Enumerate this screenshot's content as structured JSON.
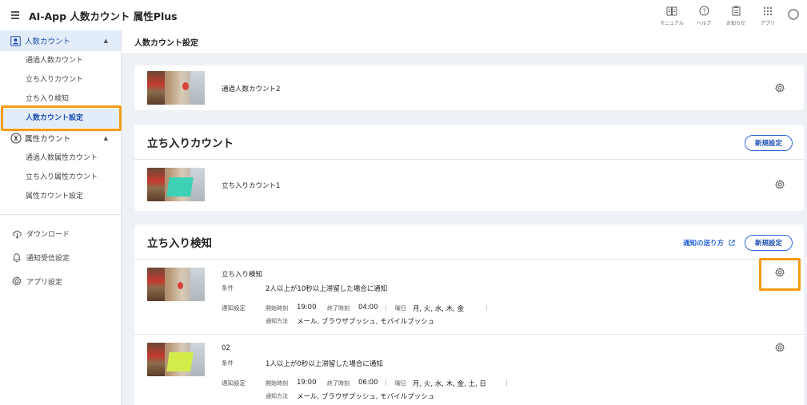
{
  "header": {
    "title": "AI-App 人数カウント 属性Plus",
    "icons": [
      {
        "icon": "manual-icon",
        "label": "マニュアル"
      },
      {
        "icon": "help-icon",
        "label": "ヘルプ"
      },
      {
        "icon": "notice-icon",
        "label": "お知らせ"
      },
      {
        "icon": "apps-icon",
        "label": "アプリ"
      }
    ]
  },
  "sidebar": {
    "group1": {
      "label": "人数カウント",
      "items": [
        "通過人数カウント",
        "立ち入りカウント",
        "立ち入り検知",
        "人数カウント設定"
      ]
    },
    "group2": {
      "label": "属性カウント",
      "items": [
        "通過人数属性カウント",
        "立ち入り属性カウント",
        "属性カウント設定"
      ]
    },
    "download": "ダウンロード",
    "notify_settings": "通知受信設定",
    "app_settings": "アプリ設定"
  },
  "main": {
    "page_title": "人数カウント設定",
    "pass_row": {
      "name": "通過人数カウント2"
    },
    "entry": {
      "title": "立ち入りカウント",
      "new_label": "新規設定",
      "rows": [
        {
          "name": "立ち入りカウント1"
        }
      ]
    },
    "detect": {
      "title": "立ち入り検知",
      "help_link": "通知の送り方",
      "new_label": "新規設定",
      "rows": [
        {
          "name": "立ち入り検知",
          "cond_label": "条件",
          "cond": "2人以上が10秒以上滞留した場合に通知",
          "notify_label": "通知設定",
          "start_label": "開始時刻",
          "start": "19:00",
          "end_label": "終了時刻",
          "end": "04:00",
          "sep1": "|",
          "day_label": "曜日",
          "days": "月, 火, 水, 木, 金",
          "sep2": "|",
          "method_label": "通知方法",
          "methods": "メール, ブラウザプッシュ, モバイルプッシュ"
        },
        {
          "name": "02",
          "cond_label": "条件",
          "cond": "1人以上が0秒以上滞留した場合に通知",
          "notify_label": "通知設定",
          "start_label": "開始時刻",
          "start": "19:00",
          "end_label": "終了時刻",
          "end": "06:00",
          "sep1": "|",
          "day_label": "曜日",
          "days": "月, 火, 水, 木, 金, 土, 日",
          "sep2": "|",
          "method_label": "通知方法",
          "methods": "メール, ブラウザプッシュ, モバイルプッシュ"
        }
      ]
    }
  },
  "colors": {
    "accent": "#1f4fb4",
    "highlight": "#f59a14",
    "zone_red": "#d8443a",
    "zone_teal": "#3fd1b6",
    "zone_yellow": "#d4ec4a"
  }
}
